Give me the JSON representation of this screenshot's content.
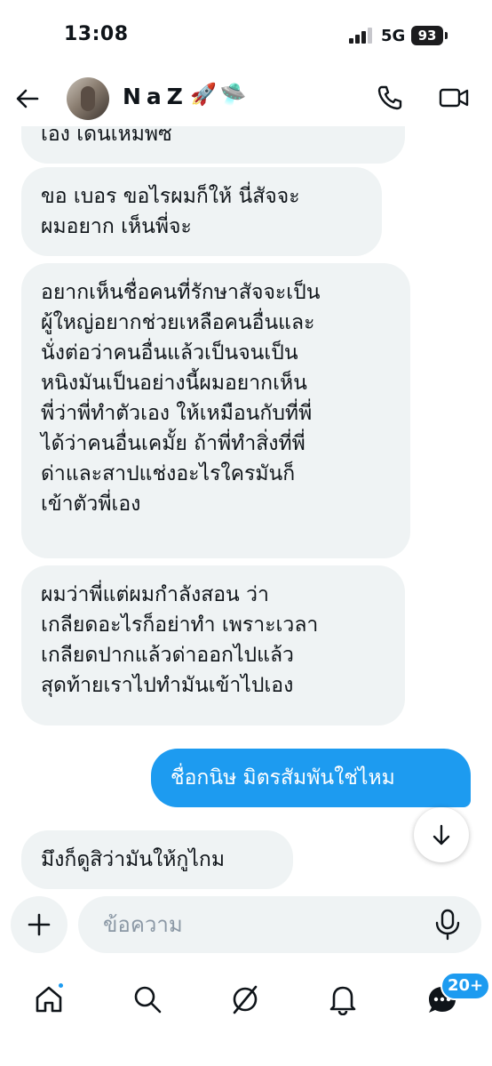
{
  "status_bar": {
    "time": "13:08",
    "network": "5G",
    "battery": "93"
  },
  "header": {
    "contact_name": "NaZ",
    "name_emoji": [
      "🚀",
      "🛸"
    ],
    "back_icon": "arrow-left-icon",
    "call_icon": "phone-icon",
    "video_icon": "video-camera-icon"
  },
  "messages": [
    {
      "direction": "incoming",
      "text": "เอง เดนเหมพซ"
    },
    {
      "direction": "incoming",
      "text": "ขอ เบอร ขอไรผมก็ให้ นี่สัจจะ\nผมอยาก เห็นพี่จะ"
    },
    {
      "direction": "incoming",
      "text": "อยากเห็นชื่อคนที่รักษาสัจจะเป็น\nผู้ใหญ่อยากช่วยเหลือคนอื่นและ\nนั่งต่อว่าคนอื่นแล้วเป็นจนเป็น\nหนิงมันเป็นอย่างนี้ผมอยากเห็น\nพี่ว่าพี่ทำตัวเอง ให้เหมือนกับที่พี่\nได้ว่าคนอื่นเคมั้ย ถ้าพี่ทำสิ่งที่พี่\nด่าและสาปแช่งอะไรใครมันก็\nเข้าตัวพี่เอง"
    },
    {
      "direction": "incoming",
      "text": "ผมว่าพี่แต่ผมกำลังสอน ว่า\nเกลียดอะไรก็อย่าทำ เพราะเวลา\nเกลียดปากแล้วด่าออกไปแล้ว\nสุดท้ายเราไปทำมันเข้าไปเอง"
    },
    {
      "direction": "outgoing",
      "text": "ชื่อกนิษ มิตรสัมพันใช่ไหม"
    },
    {
      "direction": "incoming",
      "text": "มึงก็ดูสิว่ามันให้กูไกม"
    }
  ],
  "composer": {
    "placeholder": "ข้อความ",
    "add_icon": "plus-icon",
    "mic_icon": "microphone-icon"
  },
  "scroll_down_icon": "arrow-down-icon",
  "bottom_nav": {
    "items": [
      "home-icon",
      "search-icon",
      "grok-icon",
      "bell-icon",
      "messages-icon"
    ],
    "messages_badge": "20+"
  },
  "colors": {
    "accent": "#1d9bf0",
    "bubble_incoming": "#eff3f4",
    "text": "#0f1419"
  }
}
